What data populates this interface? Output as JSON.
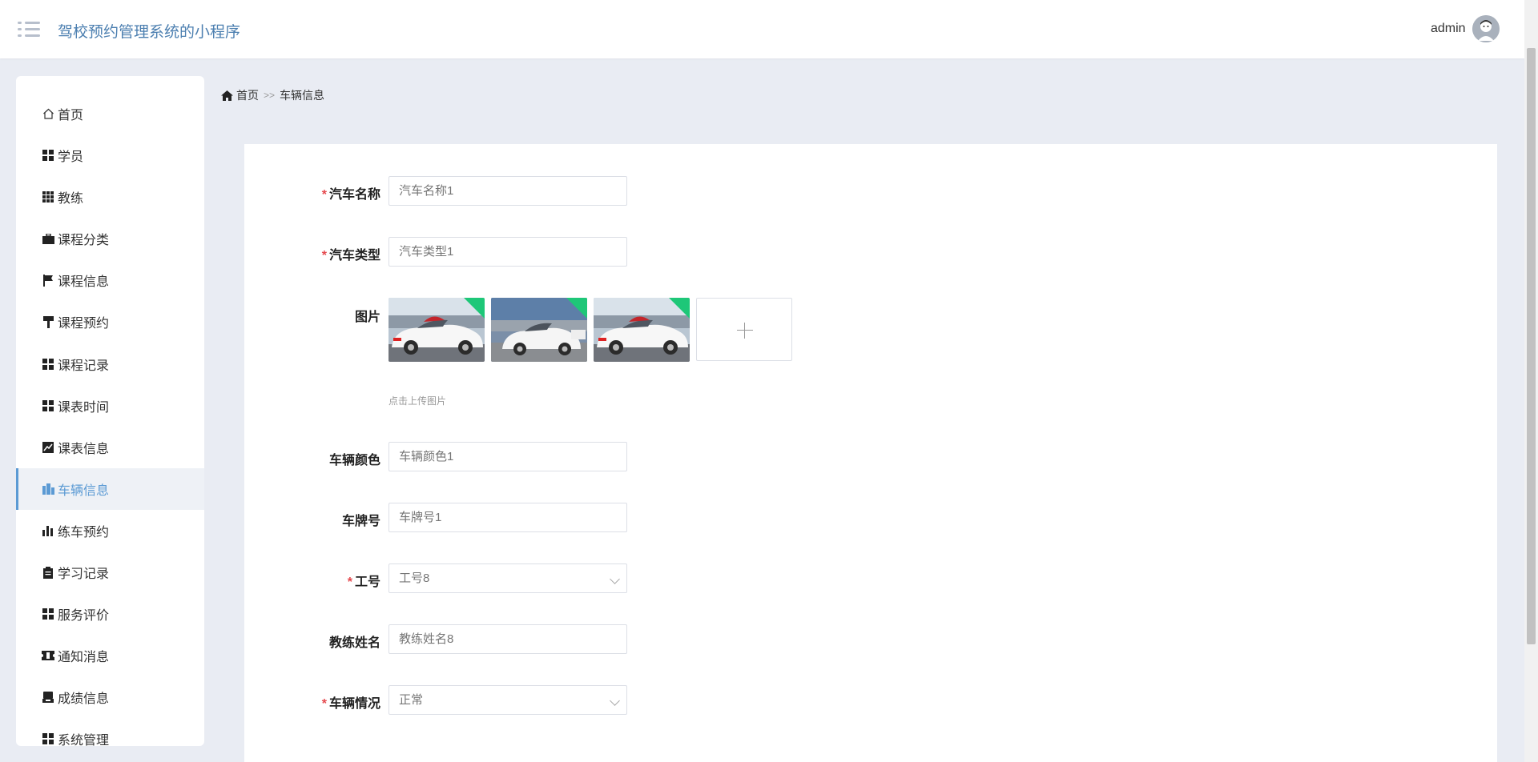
{
  "header": {
    "app_title": "驾校预约管理系统的小程序",
    "username": "admin"
  },
  "sidebar": {
    "items": [
      {
        "label": "首页",
        "icon": "home-icon"
      },
      {
        "label": "学员",
        "icon": "grid-icon"
      },
      {
        "label": "教练",
        "icon": "grid-nine-icon"
      },
      {
        "label": "课程分类",
        "icon": "briefcase-icon"
      },
      {
        "label": "课程信息",
        "icon": "flag-icon"
      },
      {
        "label": "课程预约",
        "icon": "paint-roller-icon"
      },
      {
        "label": "课程记录",
        "icon": "grid-icon"
      },
      {
        "label": "课表时间",
        "icon": "grid-icon"
      },
      {
        "label": "课表信息",
        "icon": "line-chart-icon"
      },
      {
        "label": "车辆信息",
        "icon": "building-icon",
        "active": true
      },
      {
        "label": "练车预约",
        "icon": "bar-chart-icon"
      },
      {
        "label": "学习记录",
        "icon": "clipboard-icon"
      },
      {
        "label": "服务评价",
        "icon": "grid-icon"
      },
      {
        "label": "通知消息",
        "icon": "ticket-icon"
      },
      {
        "label": "成绩信息",
        "icon": "inbox-icon"
      },
      {
        "label": "系统管理",
        "icon": "grid-icon"
      }
    ]
  },
  "breadcrumb": {
    "home": "首页",
    "separator": ">>",
    "current": "车辆信息"
  },
  "form": {
    "car_name": {
      "label": "汽车名称",
      "placeholder": "汽车名称1"
    },
    "car_type": {
      "label": "汽车类型",
      "placeholder": "汽车类型1"
    },
    "image": {
      "label": "图片",
      "hint": "点击上传图片"
    },
    "car_color": {
      "label": "车辆颜色",
      "placeholder": "车辆颜色1"
    },
    "plate": {
      "label": "车牌号",
      "placeholder": "车牌号1"
    },
    "job_no": {
      "label": "工号",
      "value": "工号8"
    },
    "coach_name": {
      "label": "教练姓名",
      "placeholder": "教练姓名8"
    },
    "car_status": {
      "label": "车辆情况",
      "value": "正常"
    }
  },
  "colors": {
    "accent": "#5b9ad4",
    "title": "#4c7fb0",
    "required": "#e5484d",
    "badge": "#1ec778",
    "background": "#e9ecf3"
  }
}
